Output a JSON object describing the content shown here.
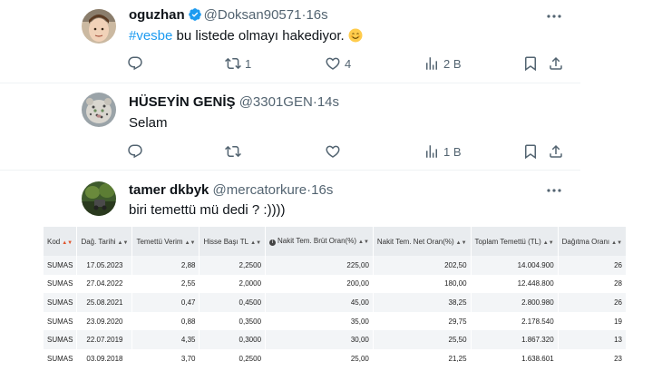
{
  "tweets": [
    {
      "name": "oguzhan",
      "handle": "@Doksan90571",
      "dot": "·",
      "time": "16s",
      "hashtag": "#vesbe",
      "text": " bu listede olmayı hakediyor. ",
      "reply_count": "",
      "retweet_count": "1",
      "like_count": "4",
      "views": "2 B",
      "verified": true
    },
    {
      "name": "HÜSEYİN GENİŞ",
      "handle": "@3301GEN",
      "dot": "·",
      "time": "14s",
      "text": "Selam",
      "reply_count": "",
      "retweet_count": "",
      "like_count": "",
      "views": "1 B"
    },
    {
      "name": "tamer dkbyk",
      "handle": "@mercatorkure",
      "dot": "·",
      "time": "16s",
      "text": "biri temettü  mü dedi ? :))))"
    }
  ],
  "table": {
    "headers": {
      "kod": "Kod",
      "dag_tarihi": "Dağ. Tarihi",
      "temettu_verim": "Temettü Verim",
      "hisse_basi": "Hisse Başı TL",
      "brut_oran": "Nakit Tem. Brüt Oran(%)",
      "net_oran": "Nakit Tem. Net Oran(%)",
      "toplam": "Toplam Temettü (TL)",
      "dagitma": "Dağıtma Oranı"
    },
    "rows": [
      {
        "kod": "SUMAS",
        "tarih": "17.05.2023",
        "verim": "2,88",
        "hisse": "2,2500",
        "brut": "225,00",
        "net": "202,50",
        "toplam": "14.004.900",
        "dagitma": "26"
      },
      {
        "kod": "SUMAS",
        "tarih": "27.04.2022",
        "verim": "2,55",
        "hisse": "2,0000",
        "brut": "200,00",
        "net": "180,00",
        "toplam": "12.448.800",
        "dagitma": "28"
      },
      {
        "kod": "SUMAS",
        "tarih": "25.08.2021",
        "verim": "0,47",
        "hisse": "0,4500",
        "brut": "45,00",
        "net": "38,25",
        "toplam": "2.800.980",
        "dagitma": "26"
      },
      {
        "kod": "SUMAS",
        "tarih": "23.09.2020",
        "verim": "0,88",
        "hisse": "0,3500",
        "brut": "35,00",
        "net": "29,75",
        "toplam": "2.178.540",
        "dagitma": "19"
      },
      {
        "kod": "SUMAS",
        "tarih": "22.07.2019",
        "verim": "4,35",
        "hisse": "0,3000",
        "brut": "30,00",
        "net": "25,50",
        "toplam": "1.867.320",
        "dagitma": "13"
      },
      {
        "kod": "SUMAS",
        "tarih": "03.09.2018",
        "verim": "3,70",
        "hisse": "0,2500",
        "brut": "25,00",
        "net": "21,25",
        "toplam": "1.638.601",
        "dagitma": "23"
      }
    ]
  },
  "icons": {
    "reply": "reply-icon",
    "retweet": "retweet-icon",
    "like": "heart-icon",
    "views": "views-icon",
    "bookmark": "bookmark-icon",
    "share": "share-icon",
    "more": "more-icon",
    "verified": "verified-badge-icon",
    "emoji": "smiling-face-emoji",
    "info": "info-icon",
    "sort": "sort-icon"
  },
  "colors": {
    "accent": "#1d9bf0",
    "secondary_text": "#536471",
    "table_header_bg": "#e9ecef",
    "sort_active": "#e0552d"
  }
}
